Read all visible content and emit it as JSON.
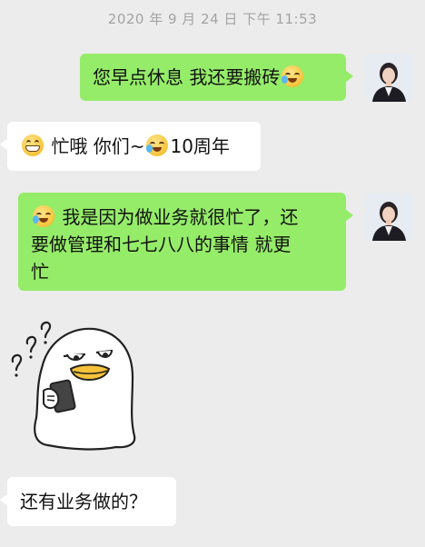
{
  "chat": {
    "timestamp": "2020 年 9 月 24 日  下午 11:53",
    "messages": [
      {
        "id": "m1",
        "side": "out",
        "text_before": "您早点休息 我还要搬砖",
        "emoji_after": "cry-laugh-emoji"
      },
      {
        "id": "m2",
        "side": "in",
        "emoji_before": "grin-emoji",
        "text_mid": "忙哦 你们~",
        "emoji_mid": "cry-laugh-emoji",
        "text_after": "10周年"
      },
      {
        "id": "m3",
        "side": "out",
        "emoji_before": "cry-laugh-emoji",
        "line1": "我是因为做业务就很忙了，还",
        "line2": "要做管理和七七八八的事情 就更",
        "line3": "忙"
      },
      {
        "id": "m4",
        "side": "in",
        "type": "sticker",
        "sticker": "duck-with-phone-confused-sticker"
      },
      {
        "id": "m5",
        "side": "in",
        "text": "还有业务做的？"
      }
    ]
  },
  "colors": {
    "background": "#ececec",
    "outgoing_bubble": "#95ec69",
    "incoming_bubble": "#ffffff",
    "timestamp": "#a3a3a3"
  }
}
